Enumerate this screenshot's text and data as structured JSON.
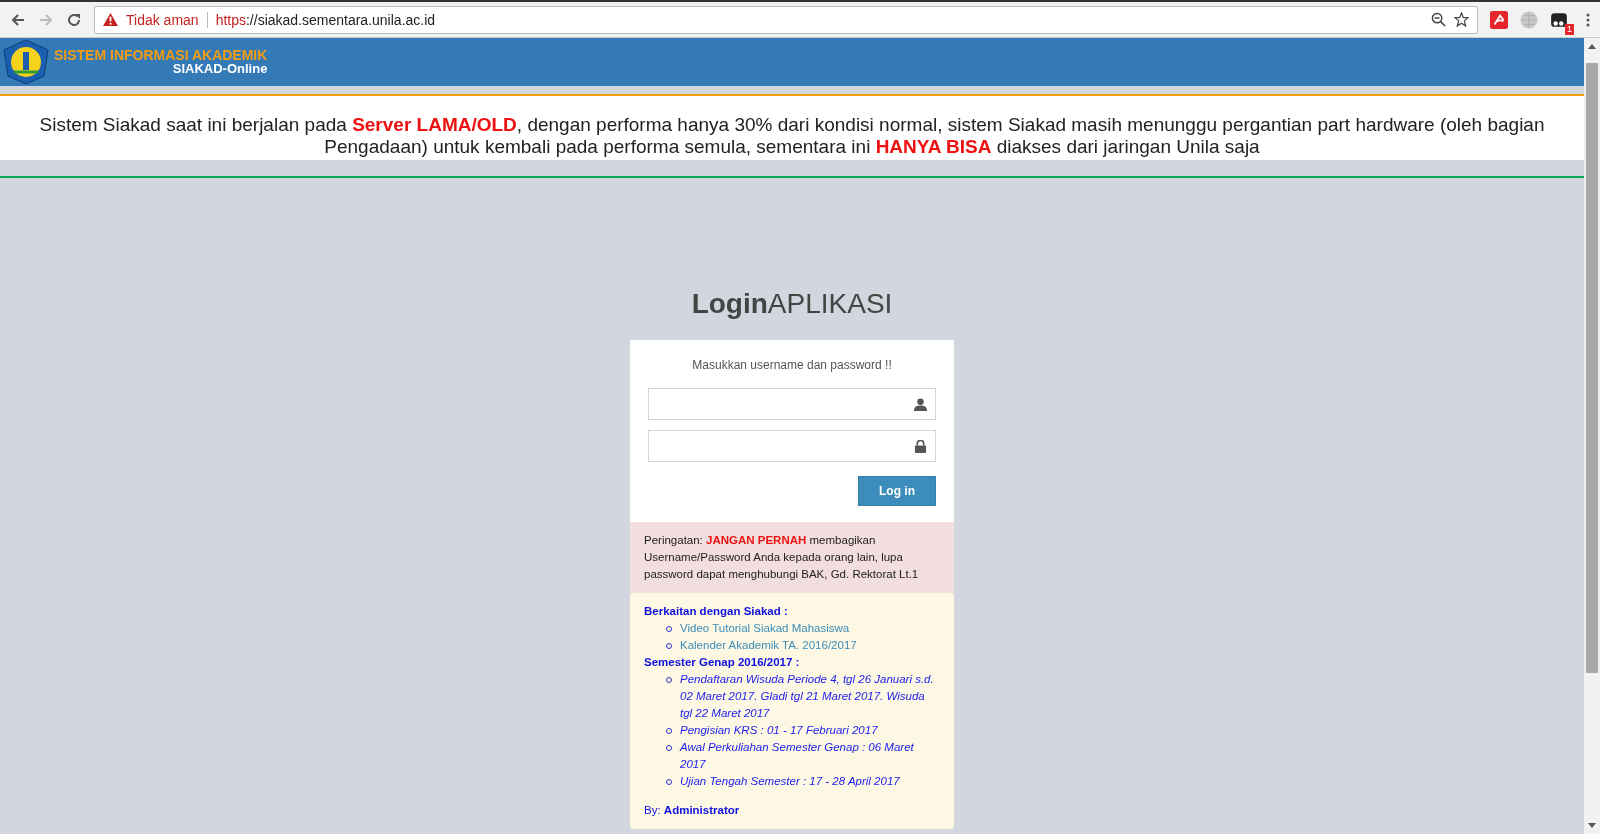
{
  "browser": {
    "security_label": "Tidak aman",
    "url_scheme": "https",
    "url_rest": "://siakad.sementara.unila.ac.id",
    "extension_badge": "1"
  },
  "header": {
    "title": "SISTEM INFORMASI AKADEMIK",
    "subtitle": "SIAKAD-Online"
  },
  "notice": "Sistem Siakad saat ini berjalan pada **Server LAMA/OLD**, dengan performa hanya 30% dari kondisi normal, sistem Siakad masih menunggu pergantian part hardware (oleh bagian Pengadaan) untuk kembali pada performa semula, sementara ini **HANYA BISA** diakses dari jaringan Unila saja",
  "login": {
    "title": "**Login**APLIKASI",
    "prompt": "Masukkan username dan password !!",
    "button": "Log in"
  },
  "warning": "Peringatan: **JANGAN PERNAH** membagikan Username/Password Anda kepada orang lain, lupa password dapat menghubungi BAK, Gd. Rektorat Lt.1",
  "info": {
    "sections": [
      {
        "heading": "Berkaitan dengan Siakad :",
        "kind": "links",
        "items": [
          "Video Tutorial Siakad Mahasiswa",
          "Kalender Akademik TA. 2016/2017"
        ]
      },
      {
        "heading": "Semester Genap 2016/2017 :",
        "kind": "announcements",
        "items": [
          "Pendaftaran Wisuda Periode 4, tgl 26 Januari s.d. 02 Maret 2017. Gladi tgl 21 Maret 2017. Wisuda tgl 22 Maret 2017",
          "Pengisian KRS : 01 - 17 Februari 2017",
          "Awal Perkuliahan Semester Genap : 06 Maret 2017",
          "Ujian Tengah Semester : 17 - 28 April 2017"
        ]
      }
    ],
    "by_label": "By:",
    "by_name": "Administrator"
  }
}
